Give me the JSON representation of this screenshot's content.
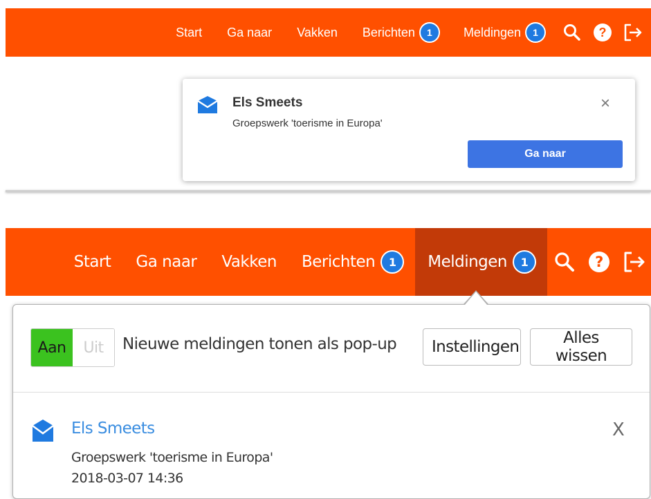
{
  "top_nav": {
    "start": "Start",
    "goto": "Ga naar",
    "courses": "Vakken",
    "messages": "Berichten",
    "messages_count": "1",
    "notifications": "Meldingen",
    "notifications_count": "1",
    "help_glyph": "?",
    "icons": [
      "search-icon",
      "help-icon",
      "logout-icon"
    ]
  },
  "toast": {
    "sender": "Els Smeets",
    "subject": "Groepswerk 'toerisme in Europa'",
    "close": "×",
    "goto_button": "Ga naar"
  },
  "bottom_nav": {
    "start": "Start",
    "goto": "Ga naar",
    "courses": "Vakken",
    "messages": "Berichten",
    "messages_count": "1",
    "notifications": "Meldingen",
    "notifications_count": "1",
    "help_glyph": "?"
  },
  "notifications_panel": {
    "toggle_on": "Aan",
    "toggle_off": "Uit",
    "popup_label": "Nieuwe meldingen tonen als pop-up",
    "settings_button": "Instellingen",
    "clear_all_button": "Alles wissen",
    "items": [
      {
        "sender": "Els Smeets",
        "subject": "Groepswerk 'toerisme in Europa'",
        "date": "2018-03-07 14:36",
        "close": "X"
      }
    ]
  },
  "colors": {
    "navbar": "#ff5000",
    "navbar_active": "#c23a08",
    "badge": "#1f7ae0",
    "primary_button": "#3d74e3",
    "toggle_on": "#3bc21f",
    "link": "#3a8de0"
  }
}
